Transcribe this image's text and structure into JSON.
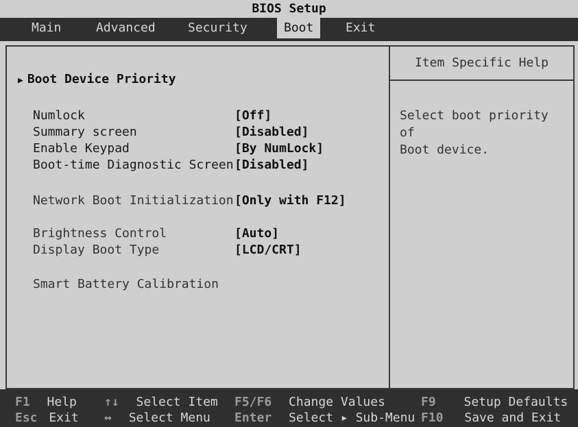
{
  "title": "BIOS Setup",
  "menu": [
    "Main",
    "Advanced",
    "Security",
    "Boot",
    "Exit"
  ],
  "active_menu": "Boot",
  "submenu": {
    "label": "Boot Device Priority"
  },
  "settings": [
    {
      "label": "Numlock",
      "value": "[Off]"
    },
    {
      "label": "Summary screen",
      "value": "[Disabled]"
    },
    {
      "label": "Enable Keypad",
      "value": "[By NumLock]"
    },
    {
      "label": "Boot-time Diagnostic Screen",
      "value": "[Disabled]"
    },
    {
      "label": "Network Boot Initialization",
      "value": "[Only with F12]"
    },
    {
      "label": "Brightness Control",
      "value": "[Auto]"
    },
    {
      "label": "Display Boot Type",
      "value": "[LCD/CRT]"
    },
    {
      "label": "Smart Battery Calibration",
      "value": ""
    }
  ],
  "help": {
    "header": "Item Specific Help",
    "text": "Select boot priority of\nBoot device."
  },
  "footer": [
    {
      "key": "F1",
      "label": "Help"
    },
    {
      "key": "↑↓",
      "label": "Select Item"
    },
    {
      "key": "F5/F6",
      "label": "Change Values"
    },
    {
      "key": "F9",
      "label": "Setup Defaults"
    },
    {
      "key": "Esc",
      "label": "Exit"
    },
    {
      "key": "↔",
      "label": "Select Menu"
    },
    {
      "key": "Enter",
      "label": "Select ▸ Sub-Menu"
    },
    {
      "key": "F10",
      "label": "Save and Exit"
    }
  ]
}
